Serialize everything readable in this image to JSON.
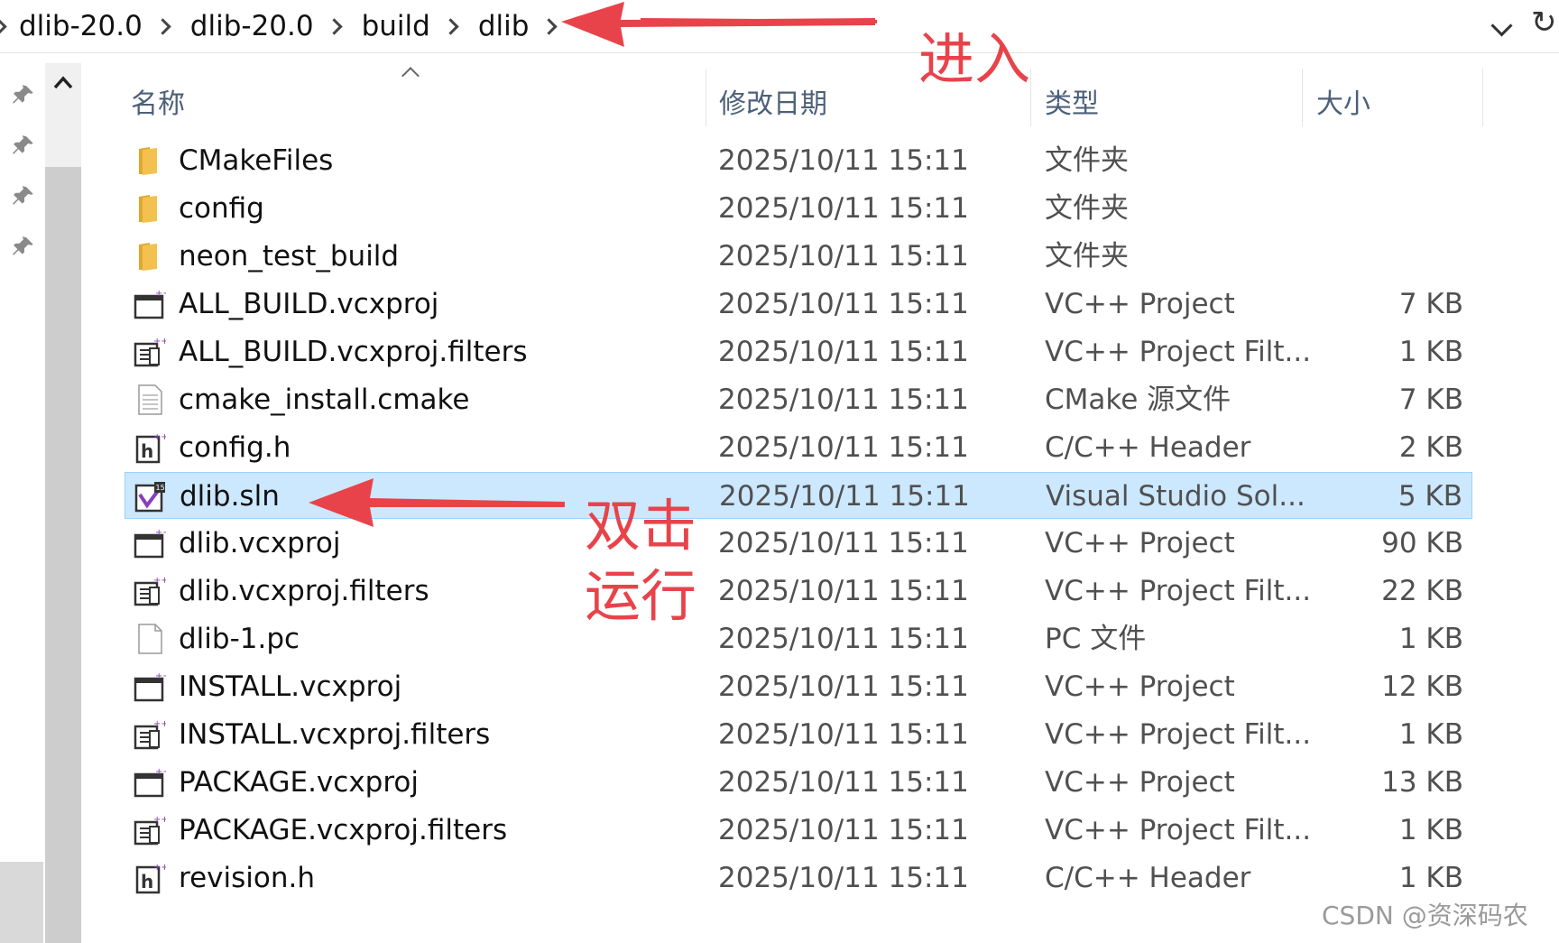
{
  "breadcrumb": [
    "dlib-20.0",
    "dlib-20.0",
    "build",
    "dlib"
  ],
  "columns": {
    "name": "名称",
    "date": "修改日期",
    "type": "类型",
    "size": "大小"
  },
  "files": [
    {
      "name": "CMakeFiles",
      "date": "2025/10/11 15:11",
      "type": "文件夹",
      "size": "",
      "icon": "folder-icon"
    },
    {
      "name": "config",
      "date": "2025/10/11 15:11",
      "type": "文件夹",
      "size": "",
      "icon": "folder-icon"
    },
    {
      "name": "neon_test_build",
      "date": "2025/10/11 15:11",
      "type": "文件夹",
      "size": "",
      "icon": "folder-icon"
    },
    {
      "name": "ALL_BUILD.vcxproj",
      "date": "2025/10/11 15:11",
      "type": "VC++ Project",
      "size": "7 KB",
      "icon": "vcxproj-icon"
    },
    {
      "name": "ALL_BUILD.vcxproj.filters",
      "date": "2025/10/11 15:11",
      "type": "VC++ Project Filt...",
      "size": "1 KB",
      "icon": "filters-icon"
    },
    {
      "name": "cmake_install.cmake",
      "date": "2025/10/11 15:11",
      "type": "CMake 源文件",
      "size": "7 KB",
      "icon": "text-file-icon"
    },
    {
      "name": "config.h",
      "date": "2025/10/11 15:11",
      "type": "C/C++ Header",
      "size": "2 KB",
      "icon": "header-file-icon"
    },
    {
      "name": "dlib.sln",
      "date": "2025/10/11 15:11",
      "type": "Visual Studio Sol...",
      "size": "5 KB",
      "icon": "solution-icon",
      "selected": true
    },
    {
      "name": "dlib.vcxproj",
      "date": "2025/10/11 15:11",
      "type": "VC++ Project",
      "size": "90 KB",
      "icon": "vcxproj-icon"
    },
    {
      "name": "dlib.vcxproj.filters",
      "date": "2025/10/11 15:11",
      "type": "VC++ Project Filt...",
      "size": "22 KB",
      "icon": "filters-icon"
    },
    {
      "name": "dlib-1.pc",
      "date": "2025/10/11 15:11",
      "type": "PC 文件",
      "size": "1 KB",
      "icon": "blank-file-icon"
    },
    {
      "name": "INSTALL.vcxproj",
      "date": "2025/10/11 15:11",
      "type": "VC++ Project",
      "size": "12 KB",
      "icon": "vcxproj-icon"
    },
    {
      "name": "INSTALL.vcxproj.filters",
      "date": "2025/10/11 15:11",
      "type": "VC++ Project Filt...",
      "size": "1 KB",
      "icon": "filters-icon"
    },
    {
      "name": "PACKAGE.vcxproj",
      "date": "2025/10/11 15:11",
      "type": "VC++ Project",
      "size": "13 KB",
      "icon": "vcxproj-icon"
    },
    {
      "name": "PACKAGE.vcxproj.filters",
      "date": "2025/10/11 15:11",
      "type": "VC++ Project Filt...",
      "size": "1 KB",
      "icon": "filters-icon"
    },
    {
      "name": "revision.h",
      "date": "2025/10/11 15:11",
      "type": "C/C++ Header",
      "size": "1 KB",
      "icon": "header-file-icon"
    }
  ],
  "annotations": {
    "enter": "进入",
    "double_click_line1": "双击",
    "double_click_line2": "运行"
  },
  "watermark": "CSDN @资深码农",
  "colors": {
    "annotation": "#e8434a",
    "selection_bg": "#cce8ff",
    "selection_border": "#99d1ff",
    "folder": "#f2c14e"
  }
}
